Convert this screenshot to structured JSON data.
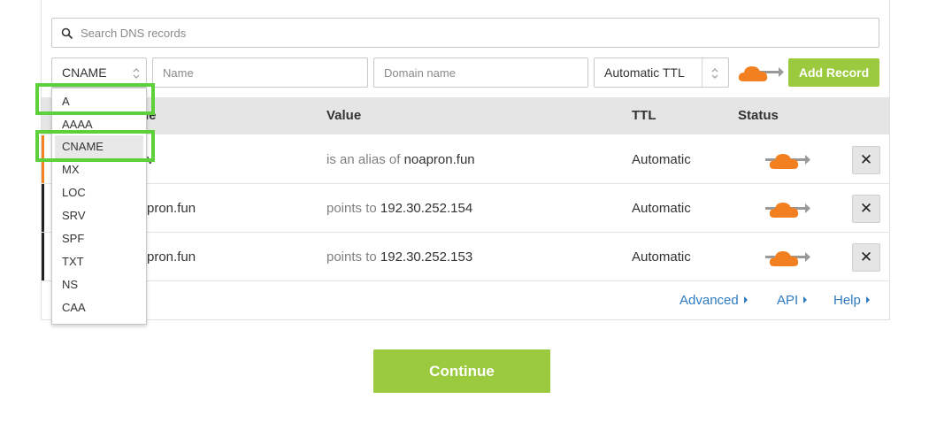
{
  "search": {
    "placeholder": "Search DNS records"
  },
  "form": {
    "type_value": "CNAME",
    "name_placeholder": "Name",
    "domain_placeholder": "Domain name",
    "ttl_value": "Automatic TTL",
    "add_label": "Add Record"
  },
  "table": {
    "headers": [
      "ne",
      "Value",
      "TTL",
      "Status"
    ],
    "rows": [
      {
        "name": "v",
        "value_prefix": "is an alias of",
        "value": "noapron.fun",
        "ttl": "Automatic",
        "delete": "✕"
      },
      {
        "name": "pron.fun",
        "value_prefix": "points to",
        "value": "192.30.252.154",
        "ttl": "Automatic",
        "delete": "✕"
      },
      {
        "name": "pron.fun",
        "value_prefix": "points to",
        "value": "192.30.252.153",
        "ttl": "Automatic",
        "delete": "✕"
      }
    ]
  },
  "links": {
    "advanced": "Advanced",
    "api": "API",
    "help": "Help"
  },
  "continue_label": "Continue",
  "dropdown": {
    "options": [
      "A",
      "AAAA",
      "CNAME",
      "MX",
      "LOC",
      "SRV",
      "SPF",
      "TXT",
      "NS",
      "CAA"
    ],
    "selected": "CNAME"
  },
  "colors": {
    "accent_green": "#9bca3e",
    "cloud_orange": "#f38020",
    "link_blue": "#2f7bbf",
    "highlight": "#5ed13a"
  },
  "icons": {
    "search": "search-icon",
    "proxy": "cloud-proxy-icon",
    "delete": "close-icon"
  }
}
